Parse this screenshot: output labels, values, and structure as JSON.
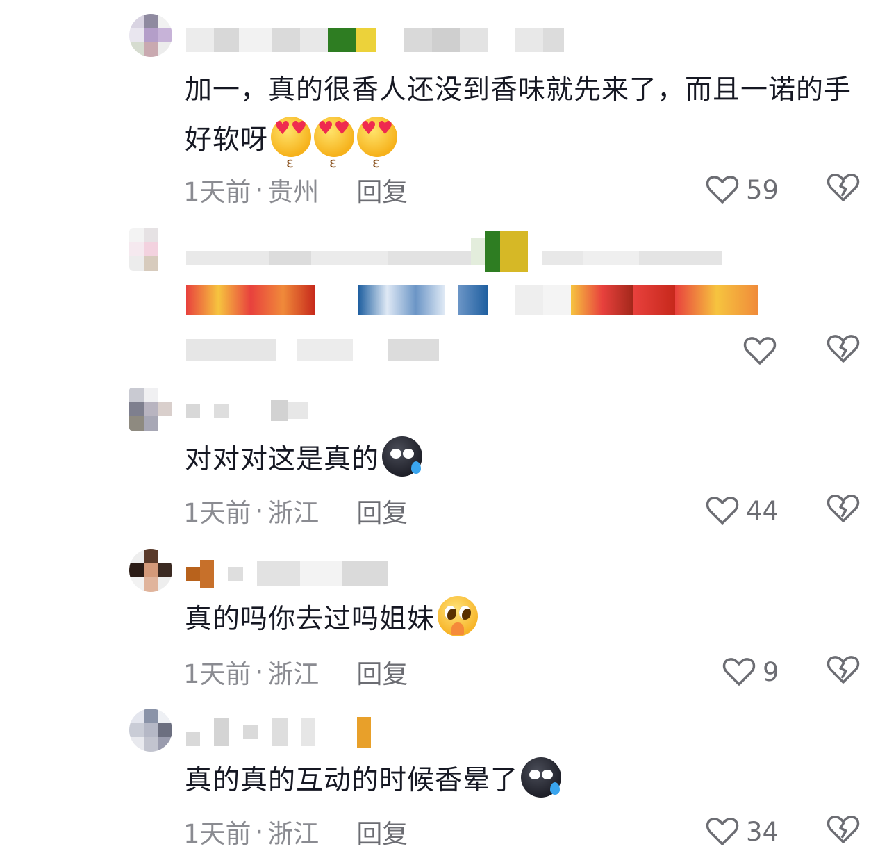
{
  "comments": [
    {
      "text": "加一，真的很香人还没到香味就先来了，而且一诺的手好软呀",
      "emoji_count": 3,
      "emoji": "heart-eyes-kiss-emoji",
      "time": "1天前",
      "sep": "·",
      "location": "贵州",
      "reply": "回复",
      "likes": "59"
    },
    {
      "text": "",
      "time": "",
      "location": "",
      "reply": "",
      "likes": ""
    },
    {
      "text": "对对对这是真的",
      "emoji": "sweat-dark-face-emoji",
      "time": "1天前",
      "sep": "·",
      "location": "浙江",
      "reply": "回复",
      "likes": "44"
    },
    {
      "text": "真的吗你去过吗姐妹",
      "emoji": "begging-face-emoji",
      "time": "1天前",
      "sep": "·",
      "location": "浙江",
      "reply": "回复",
      "likes": "9"
    },
    {
      "text": "真的真的互动的时候香晕了",
      "emoji": "sweat-dark-face-emoji",
      "time": "1天前",
      "sep": "·",
      "location": "浙江",
      "reply": "回复",
      "likes": "34"
    }
  ],
  "colors": {
    "text": "#161823",
    "meta": "#8a8b91",
    "action": "#6c6d73",
    "background": "#ffffff"
  },
  "icons": {
    "like": "heart-outline-icon",
    "dislike": "broken-heart-icon"
  }
}
